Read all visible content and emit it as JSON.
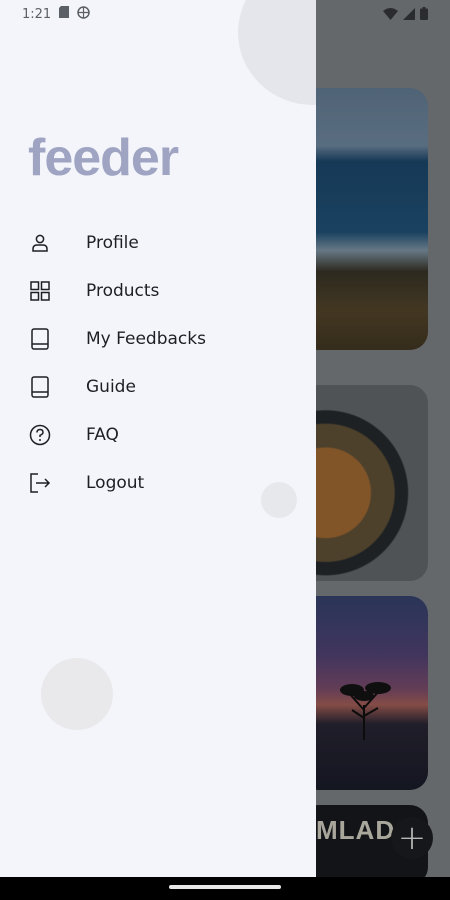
{
  "status_bar": {
    "time": "1:21"
  },
  "app": {
    "logo_text": "feeder"
  },
  "menu": {
    "items": [
      {
        "label": "Profile",
        "icon": "person-icon"
      },
      {
        "label": "Products",
        "icon": "grid-icon"
      },
      {
        "label": "My Feedbacks",
        "icon": "book-icon"
      },
      {
        "label": "Guide",
        "icon": "book-icon"
      },
      {
        "label": "FAQ",
        "icon": "help-circle-icon"
      },
      {
        "label": "Logout",
        "icon": "logout-icon"
      }
    ]
  },
  "background": {
    "card_bottom_text": "MLAD",
    "fab_symbol": "+"
  },
  "colors": {
    "logo": "#9ea4c2",
    "drawer_bg": "#f4f5fa",
    "text": "#1d1f24"
  }
}
